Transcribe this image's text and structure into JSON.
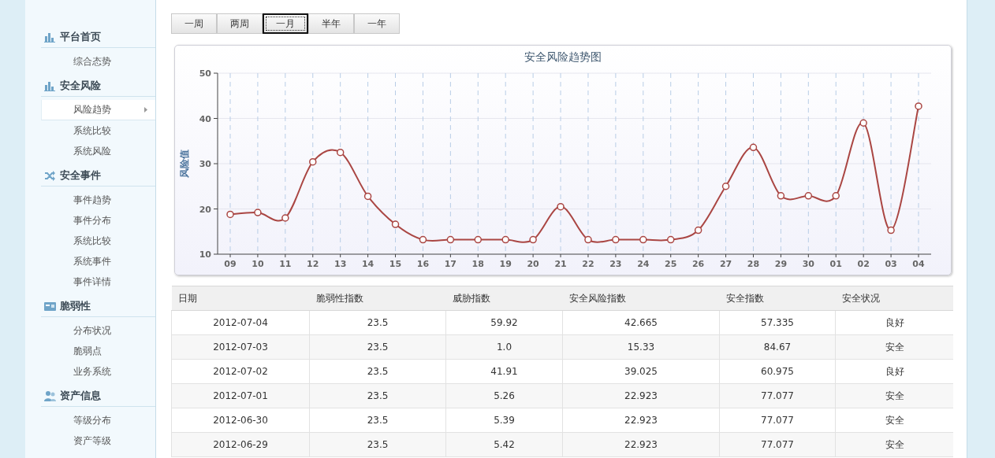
{
  "sidebar": {
    "groups": [
      {
        "title": "平台首页",
        "items": [
          {
            "label": "综合态势",
            "selected": false
          }
        ]
      },
      {
        "title": "安全风险",
        "items": [
          {
            "label": "风险趋势",
            "selected": true
          },
          {
            "label": "系统比较",
            "selected": false
          },
          {
            "label": "系统风险",
            "selected": false
          }
        ]
      },
      {
        "title": "安全事件",
        "items": [
          {
            "label": "事件趋势",
            "selected": false
          },
          {
            "label": "事件分布",
            "selected": false
          },
          {
            "label": "系统比较",
            "selected": false
          },
          {
            "label": "系统事件",
            "selected": false
          },
          {
            "label": "事件详情",
            "selected": false
          }
        ]
      },
      {
        "title": "脆弱性",
        "items": [
          {
            "label": "分布状况",
            "selected": false
          },
          {
            "label": "脆弱点",
            "selected": false
          },
          {
            "label": "业务系统",
            "selected": false
          }
        ]
      },
      {
        "title": "资产信息",
        "items": [
          {
            "label": "等级分布",
            "selected": false
          },
          {
            "label": "资产等级",
            "selected": false
          }
        ]
      }
    ]
  },
  "range_buttons": [
    {
      "label": "一周",
      "selected": false
    },
    {
      "label": "两周",
      "selected": false
    },
    {
      "label": "一月",
      "selected": true
    },
    {
      "label": "半年",
      "selected": false
    },
    {
      "label": "一年",
      "selected": false
    }
  ],
  "chart": {
    "chart_data": {
      "type": "line",
      "title": "安全风险趋势图",
      "ylabel": "风险值",
      "categories": [
        "09",
        "10",
        "11",
        "12",
        "13",
        "14",
        "15",
        "16",
        "17",
        "18",
        "19",
        "20",
        "21",
        "22",
        "23",
        "24",
        "25",
        "26",
        "27",
        "28",
        "29",
        "30",
        "01",
        "02",
        "03",
        "04"
      ],
      "series": [
        {
          "color": "#aa4643",
          "marker": true,
          "values": [
            18.8,
            19.2,
            18.0,
            30.4,
            32.5,
            22.8,
            16.6,
            13.2,
            13.2,
            13.2,
            13.2,
            13.2,
            20.5,
            13.2,
            13.2,
            13.2,
            13.2,
            15.3,
            25.0,
            33.6,
            22.9,
            22.9,
            22.9,
            39.0,
            15.3,
            42.7
          ]
        }
      ],
      "grid": true,
      "ylim": [
        10,
        50
      ],
      "yticks": [
        10,
        20,
        30,
        40,
        50
      ]
    }
  },
  "table": {
    "columns": [
      "日期",
      "脆弱性指数",
      "威胁指数",
      "安全风险指数",
      "安全指数",
      "安全状况"
    ],
    "rows": [
      [
        "2012-07-04",
        "23.5",
        "59.92",
        "42.665",
        "57.335",
        "良好"
      ],
      [
        "2012-07-03",
        "23.5",
        "1.0",
        "15.33",
        "84.67",
        "安全"
      ],
      [
        "2012-07-02",
        "23.5",
        "41.91",
        "39.025",
        "60.975",
        "良好"
      ],
      [
        "2012-07-01",
        "23.5",
        "5.26",
        "22.923",
        "77.077",
        "安全"
      ],
      [
        "2012-06-30",
        "23.5",
        "5.39",
        "22.923",
        "77.077",
        "安全"
      ],
      [
        "2012-06-29",
        "23.5",
        "5.42",
        "22.923",
        "77.077",
        "安全"
      ]
    ]
  }
}
